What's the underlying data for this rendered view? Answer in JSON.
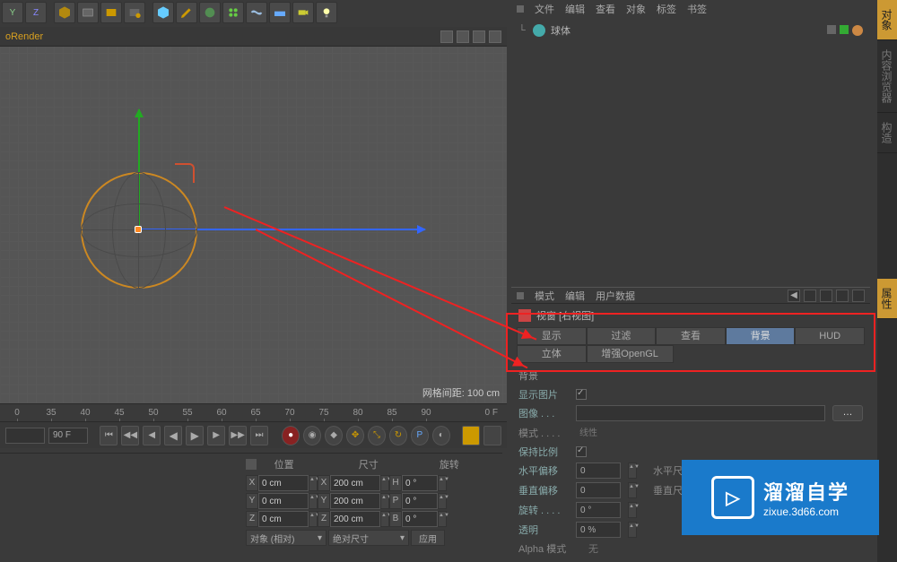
{
  "toolbar": {
    "axis_buttons": [
      "Y",
      "Z"
    ]
  },
  "viewport": {
    "label": "oRender",
    "grid_spacing_label": "网格间距: 100 cm"
  },
  "ruler": {
    "ticks": [
      "0",
      "35",
      "40",
      "45",
      "50",
      "55",
      "60",
      "65",
      "70",
      "75",
      "80",
      "85",
      "90"
    ],
    "end_label": "0 F"
  },
  "timeline": {
    "start_frame": "",
    "current_frame": "90 F"
  },
  "coords": {
    "headers": [
      "位置",
      "尺寸",
      "旋转"
    ],
    "rows": [
      {
        "axis": "X",
        "pos": "0 cm",
        "size_axis": "X",
        "size": "200 cm",
        "rot_axis": "H",
        "rot": "0 °"
      },
      {
        "axis": "Y",
        "pos": "0 cm",
        "size_axis": "Y",
        "size": "200 cm",
        "rot_axis": "P",
        "rot": "0 °"
      },
      {
        "axis": "Z",
        "pos": "0 cm",
        "size_axis": "Z",
        "size": "200 cm",
        "rot_axis": "B",
        "rot": "0 °"
      }
    ],
    "mode_pos": "对象 (相对)",
    "mode_size": "绝对尺寸",
    "apply": "应用"
  },
  "obj_mgr": {
    "menu": [
      "文件",
      "编辑",
      "查看",
      "对象",
      "标签",
      "书签"
    ],
    "item_name": "球体"
  },
  "attrib": {
    "menu": [
      "模式",
      "编辑",
      "用户数据"
    ],
    "title": "视窗 [右视图]",
    "tabs_row1": [
      "显示",
      "过滤",
      "查看",
      "背景",
      "HUD"
    ],
    "tabs_row2": [
      "立体",
      "增强OpenGL"
    ],
    "section": "背景",
    "show_image_label": "显示图片",
    "image_label": "图像 . . .",
    "mode_label": "模式 . . . .",
    "mode_value": "线性",
    "keep_ratio_label": "保持比例",
    "h_offset_label": "水平偏移",
    "h_offset_value": "0",
    "h_size_label": "水平尺寸",
    "v_offset_label": "垂直偏移",
    "v_offset_value": "0",
    "v_size_label": "垂直尺寸",
    "rotate_label": "旋转 . . . .",
    "rotate_value": "0 °",
    "opacity_label": "透明",
    "opacity_value": "0 %",
    "alpha_label": "Alpha 模式",
    "alpha_value": "无"
  },
  "right_tabs": [
    "对象",
    "内容浏览器",
    "构造",
    "属性"
  ],
  "watermark": {
    "main": "溜溜自学",
    "sub": "zixue.3d66.com"
  }
}
